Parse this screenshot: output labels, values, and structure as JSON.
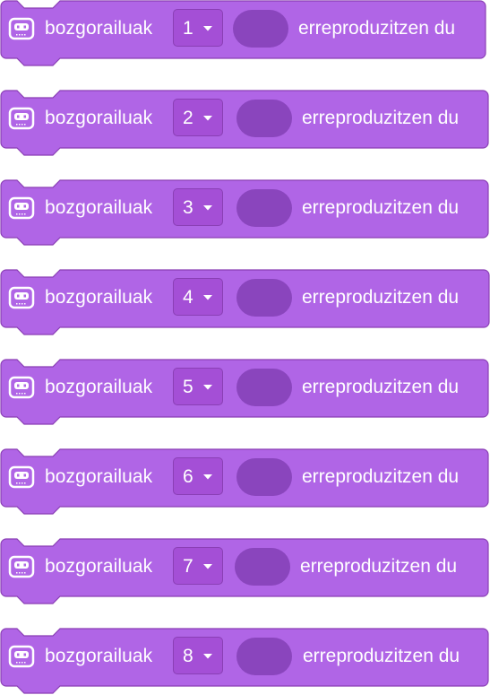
{
  "colors": {
    "block_fill": "#b065e6",
    "block_stroke": "#8a3fb5",
    "slot_fill": "#8a45bd"
  },
  "icon": "microbit-face-icon",
  "blocks": [
    {
      "label": "bozgorailuak",
      "value": "1",
      "suffix": "erreproduzitzen du"
    },
    {
      "label": "bozgorailuak",
      "value": "2",
      "suffix": "erreproduzitzen du"
    },
    {
      "label": "bozgorailuak",
      "value": "3",
      "suffix": "erreproduzitzen du"
    },
    {
      "label": "bozgorailuak",
      "value": "4",
      "suffix": "erreproduzitzen du"
    },
    {
      "label": "bozgorailuak",
      "value": "5",
      "suffix": "erreproduzitzen du"
    },
    {
      "label": "bozgorailuak",
      "value": "6",
      "suffix": "erreproduzitzen du"
    },
    {
      "label": "bozgorailuak",
      "value": "7",
      "suffix": "erreproduzitzen du"
    },
    {
      "label": "bozgorailuak",
      "value": "8",
      "suffix": "erreproduzitzen du"
    }
  ]
}
